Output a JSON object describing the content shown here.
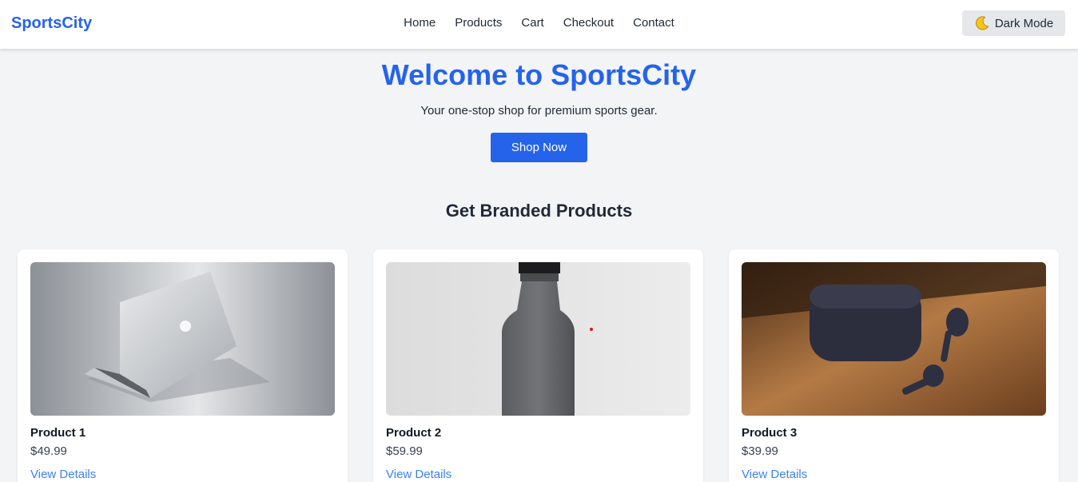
{
  "navbar": {
    "brand": "SportsCity",
    "links": [
      "Home",
      "Products",
      "Cart",
      "Checkout",
      "Contact"
    ],
    "dark_mode_label": "Dark Mode",
    "dark_mode_icon": "moon-icon"
  },
  "hero": {
    "title": "Welcome to SportsCity",
    "subtitle": "Your one-stop shop for premium sports gear.",
    "cta_label": "Shop Now"
  },
  "section": {
    "title": "Get Branded Products"
  },
  "products": [
    {
      "name": "Product 1",
      "price": "$49.99",
      "link": "View Details",
      "image": "laptop-image"
    },
    {
      "name": "Product 2",
      "price": "$59.99",
      "link": "View Details",
      "image": "bottle-image"
    },
    {
      "name": "Product 3",
      "price": "$39.99",
      "link": "View Details",
      "image": "earbuds-image"
    }
  ],
  "colors": {
    "accent": "#2563eb",
    "background": "#f3f4f6",
    "link": "#3b82f6"
  }
}
